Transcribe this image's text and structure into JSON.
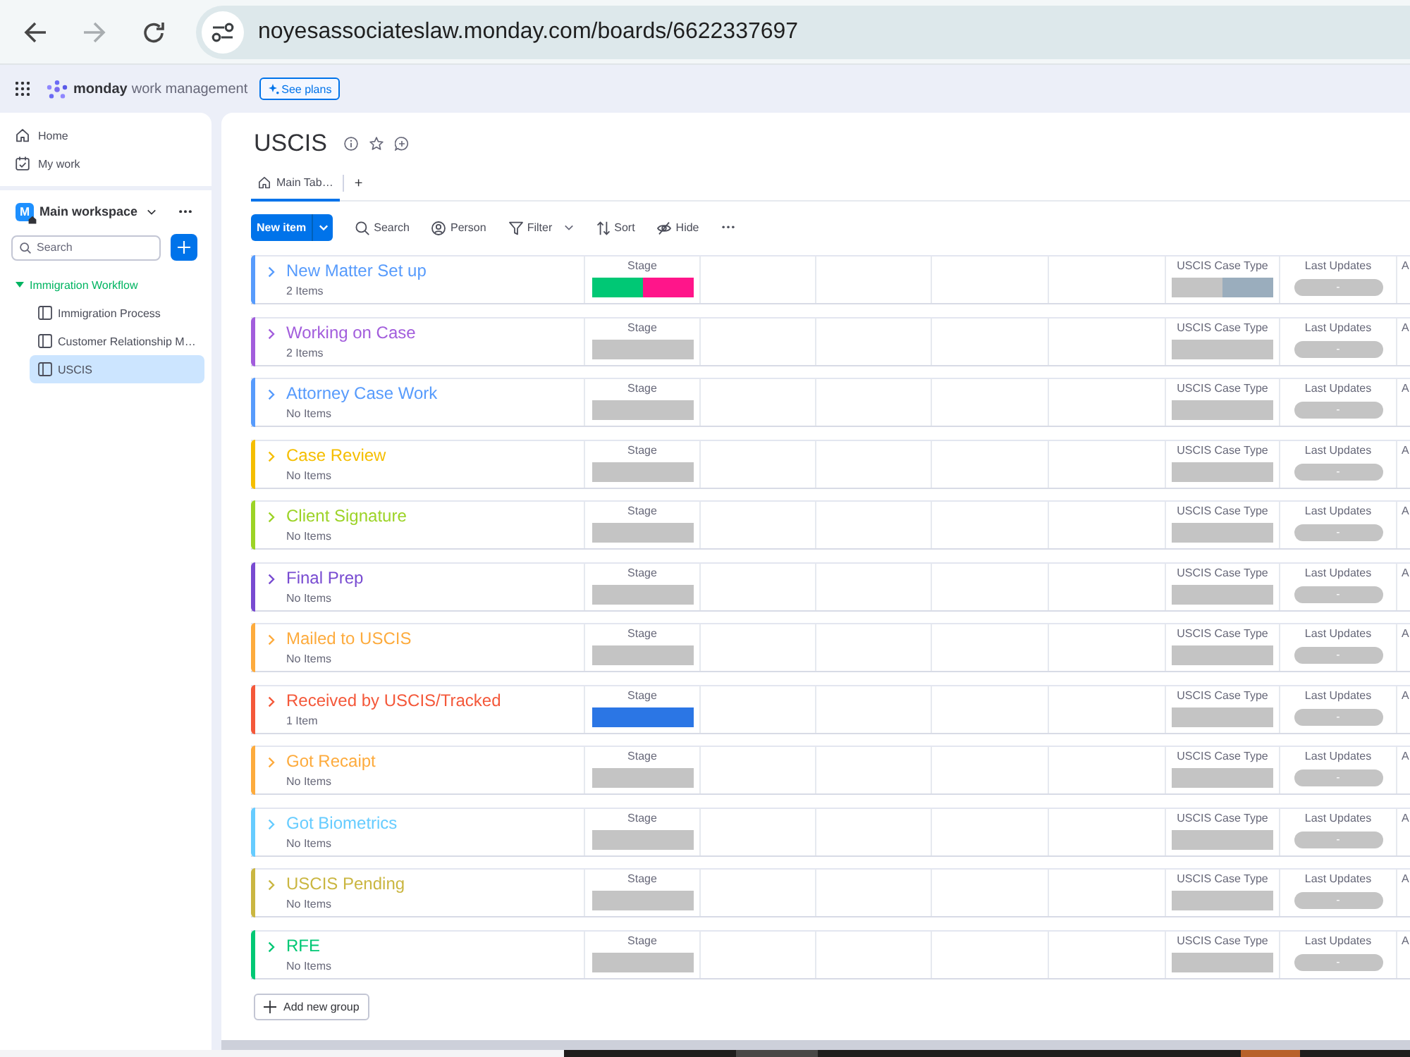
{
  "browser": {
    "nav_buttons": [
      {
        "kind": "back",
        "disabled": false
      },
      {
        "kind": "forward",
        "disabled": true
      },
      {
        "kind": "reload",
        "disabled": false
      }
    ],
    "url": "noyesassociateslaw.monday.com/boards/6622337697"
  },
  "app_bar": {
    "brand": "monday",
    "product": "work management",
    "plans_button": "See plans"
  },
  "sidebar": {
    "nav": [
      {
        "kind": "home",
        "label": "Home",
        "selected": false
      },
      {
        "kind": "my_work",
        "label": "My work",
        "selected": false
      }
    ],
    "workspace": {
      "badge": "M",
      "name": "Main workspace"
    },
    "search": {
      "placeholder": "Search"
    },
    "folders": [
      {
        "label": "Immigration Workflow",
        "expanded": true,
        "children": [
          {
            "label": "Immigration Process",
            "selected": false
          },
          {
            "label": "Customer Relationship M…",
            "selected": false
          },
          {
            "label": "USCIS",
            "selected": true
          }
        ]
      }
    ]
  },
  "board": {
    "title": "USCIS",
    "tabs": [
      {
        "label": "Main Tab…",
        "selected": true
      }
    ],
    "add_tab": "+",
    "toolbar": {
      "new_item": "New item",
      "tools": [
        {
          "kind": "search",
          "label": "Search"
        },
        {
          "kind": "person",
          "label": "Person"
        },
        {
          "kind": "filter",
          "label": "Filter"
        },
        {
          "kind": "sort",
          "label": "Sort"
        },
        {
          "kind": "hide",
          "label": "Hide"
        }
      ]
    },
    "groups": [
      {
        "name": "New Matter Set up",
        "count": "2 Items",
        "color": "#579bfc",
        "expanded": false,
        "stage": {
          "label": "Stage",
          "segments": [
            {
              "color": "#00c875"
            },
            {
              "color": "#ff158a"
            }
          ]
        },
        "case_type": {
          "label": "USCIS Case Type",
          "segments": [
            {
              "color": "#c4c4c4"
            },
            {
              "color": "#9aadbd"
            }
          ]
        },
        "last_updates": {
          "label": "Last Updates",
          "value": "-"
        },
        "column_9": {
          "label": "A"
        }
      },
      {
        "name": "Working on Case",
        "count": "2 Items",
        "color": "#a25ddc",
        "expanded": false,
        "stage": {
          "label": "Stage"
        },
        "case_type": {
          "label": "USCIS Case Type"
        },
        "last_updates": {
          "label": "Last Updates",
          "value": "-"
        },
        "column_9": {
          "label": "A"
        }
      },
      {
        "name": "Attorney Case Work",
        "count": "No Items",
        "color": "#579bfc",
        "expanded": false,
        "stage": {
          "label": "Stage"
        },
        "case_type": {
          "label": "USCIS Case Type"
        },
        "last_updates": {
          "label": "Last Updates",
          "value": "-"
        },
        "column_9": {
          "label": "A"
        }
      },
      {
        "name": "Case Review",
        "count": "No Items",
        "color": "#f5be00",
        "expanded": false,
        "stage": {
          "label": "Stage"
        },
        "case_type": {
          "label": "USCIS Case Type"
        },
        "last_updates": {
          "label": "Last Updates",
          "value": "-"
        },
        "column_9": {
          "label": "A"
        }
      },
      {
        "name": "Client Signature",
        "count": "No Items",
        "color": "#9cd326",
        "expanded": false,
        "stage": {
          "label": "Stage"
        },
        "case_type": {
          "label": "USCIS Case Type"
        },
        "last_updates": {
          "label": "Last Updates",
          "value": "-"
        },
        "column_9": {
          "label": "A"
        }
      },
      {
        "name": "Final Prep",
        "count": "No Items",
        "color": "#784bd1",
        "expanded": false,
        "stage": {
          "label": "Stage"
        },
        "case_type": {
          "label": "USCIS Case Type"
        },
        "last_updates": {
          "label": "Last Updates",
          "value": "-"
        },
        "column_9": {
          "label": "A"
        }
      },
      {
        "name": "Mailed to USCIS",
        "count": "No Items",
        "color": "#fdab3d",
        "expanded": false,
        "stage": {
          "label": "Stage"
        },
        "case_type": {
          "label": "USCIS Case Type"
        },
        "last_updates": {
          "label": "Last Updates",
          "value": "-"
        },
        "column_9": {
          "label": "A"
        }
      },
      {
        "name": "Received by USCIS/Tracked",
        "count": "1 Item",
        "color": "#f4583a",
        "expanded": false,
        "stage": {
          "label": "Stage",
          "segments": [
            {
              "color": "#2b76e5"
            }
          ]
        },
        "case_type": {
          "label": "USCIS Case Type"
        },
        "last_updates": {
          "label": "Last Updates",
          "value": "-"
        },
        "column_9": {
          "label": "A"
        }
      },
      {
        "name": "Got Recaipt",
        "count": "No Items",
        "color": "#fdab3d",
        "expanded": false,
        "stage": {
          "label": "Stage"
        },
        "case_type": {
          "label": "USCIS Case Type"
        },
        "last_updates": {
          "label": "Last Updates",
          "value": "-"
        },
        "column_9": {
          "label": "A"
        }
      },
      {
        "name": "Got Biometrics",
        "count": "No Items",
        "color": "#66ccff",
        "expanded": false,
        "stage": {
          "label": "Stage"
        },
        "case_type": {
          "label": "USCIS Case Type"
        },
        "last_updates": {
          "label": "Last Updates",
          "value": "-"
        },
        "column_9": {
          "label": "A"
        }
      },
      {
        "name": "USCIS Pending",
        "count": "No Items",
        "color": "#cab641",
        "expanded": false,
        "stage": {
          "label": "Stage"
        },
        "case_type": {
          "label": "USCIS Case Type"
        },
        "last_updates": {
          "label": "Last Updates",
          "value": "-"
        },
        "column_9": {
          "label": "A"
        }
      },
      {
        "name": "RFE",
        "count": "No Items",
        "color": "#00c875",
        "expanded": false,
        "stage": {
          "label": "Stage"
        },
        "case_type": {
          "label": "USCIS Case Type"
        },
        "last_updates": {
          "label": "Last Updates",
          "value": "-"
        },
        "column_9": {
          "label": "A"
        }
      }
    ],
    "add_group": "Add new group"
  }
}
